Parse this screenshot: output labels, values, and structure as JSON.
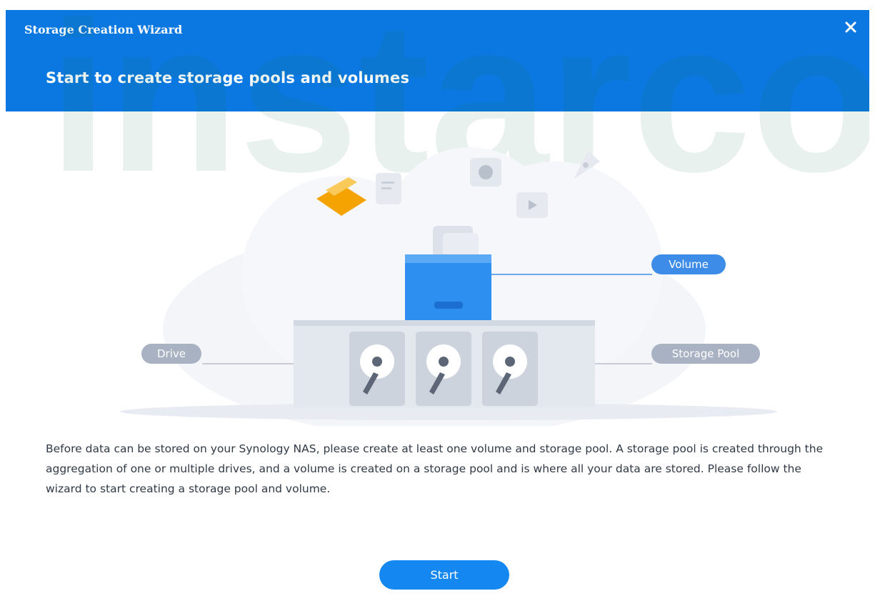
{
  "window": {
    "title": "Storage Creation Wizard",
    "subtitle": "Start to create storage pools and volumes",
    "close_icon": "close-icon"
  },
  "watermark": {
    "text": "instarco"
  },
  "diagram": {
    "volume_label": "Volume",
    "drive_label": "Drive",
    "storage_pool_label": "Storage Pool"
  },
  "description": "Before data can be stored on your Synology NAS, please create at least one volume and storage pool. A storage pool is created through the aggregation of one or multiple drives, and a volume is created on a storage pool and is where all your data are stored. Please follow the wizard to start creating a storage pool and volume.",
  "actions": {
    "start_label": "Start"
  },
  "colors": {
    "header": "#0a78e0",
    "button": "#1487f0",
    "volume_pill": "#3d8de8",
    "neutral_pill": "#a8b2c2"
  }
}
